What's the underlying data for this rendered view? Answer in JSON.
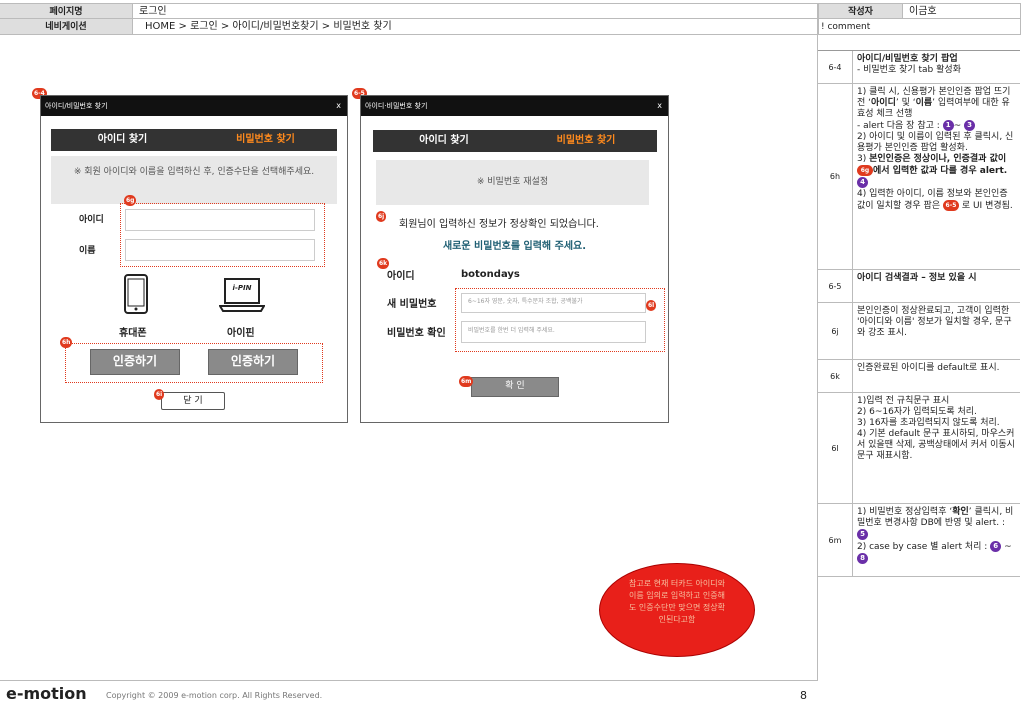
{
  "header": {
    "page_name_label": "페이지명",
    "page_name": "로그인",
    "nav_label": "네비게이션",
    "nav_path": "HOME > 로그인 > 아이디/비밀번호찾기 > 비밀번호 찾기",
    "author_label": "작성자",
    "author": "이금호",
    "comment_label": "! comment"
  },
  "popup1": {
    "marker": "6-4",
    "title": "아이디/비밀번호 찾기",
    "close": "x",
    "tab_id": "아이디 찾기",
    "tab_pw": "비밀번호 찾기",
    "notice": "※ 회원 아이디와 이름을 입력하신 후, 인증수단을 선택해주세요.",
    "badge_6g": "6g",
    "label_id": "아이디",
    "label_name": "이름",
    "phone_label": "휴대폰",
    "ipin_box": "i-PIN",
    "ipin_label": "아이핀",
    "badge_6h": "6h",
    "verify_btn_1": "인증하기",
    "verify_btn_2": "인증하기",
    "badge_6i": "6i",
    "close_btn": "닫 기"
  },
  "popup2": {
    "marker": "6-5",
    "title": "아이디·비밀번호 찾기",
    "close": "x",
    "tab_id": "아이디 찾기",
    "tab_pw": "비밀번호 찾기",
    "reset_title": "※ 비밀번호 재설정",
    "badge_6j": "6j",
    "ok_msg": "회원님이 입력하신 정보가 정상확인 되었습니다.",
    "new_pw_msg": "새로운 비밀번호를 입력해 주세요.",
    "badge_6k": "6k",
    "id_label": "아이디",
    "id_value": "botondays",
    "new_pw_label": "새 비밀번호",
    "new_pw_placeholder": "6~16자 영문, 숫자, 특수문자 조합, 공백불가",
    "badge_6l": "6l",
    "confirm_label": "비밀번호 확인",
    "confirm_placeholder": "비밀번호를 한번 더 입력해 주세요.",
    "badge_6m": "6m",
    "confirm_btn": "확 인"
  },
  "note_bubble": "참고로 현재 터카드 아이디와 이름 임의로 입력하고 인증해도 인증수단만 맞으면 정상확인된다고함",
  "comments": [
    {
      "num": "6-4",
      "text": "아이디/비밀번호 찾기 팝업\n- 비밀번호 찾기 tab 활성화"
    },
    {
      "num": "6h",
      "text": "1) 클릭 시, 신용평가 본인인증 팝업 뜨기 전 '아이디' 및 '이름' 입력여부에 대한 유효성 체크 선행\n- alert 다음 장 참고 : ❶~ ❸\n2) 아이디 및 이름이 입력된 후 클릭시, 신용평가 본인인증 팝업 활성화.\n3) 본인인증은 정상이나, 인증결과 값이 6g에서 입력한 값과 다를 경우 alert. ❹\n4) 입력한 아이디, 이름 정보와 본인인증 값이 일치할 경우 팝은 6-5 로 UI 변경됨."
    },
    {
      "num": "6-5",
      "text": "아이디 검색결과 – 정보 있을 시"
    },
    {
      "num": "6j",
      "text": "본인인증이 정상완료되고, 고객이 입력한 '아이디와 이름' 정보가 일치할 경우, 문구와 강조 표시."
    },
    {
      "num": "6k",
      "text": "인증완료된 아이디를 default로 표시."
    },
    {
      "num": "6l",
      "text": "1)입력 전 규칙문구 표시\n2) 6~16자가 입력되도록 처리.\n3) 16자를 초과입력되지 않도록 처리.\n 4) 기본 default 문구 표시하되, 마우스커서 있을땐 삭제, 공백상태에서 커서 이동시 문구 재표시함."
    },
    {
      "num": "6m",
      "text": "1) 비밀번호 정상입력후 '확인' 클릭시, 비밀번호 변경사항 DB에 반영 및 alert. : ❺\n2) case by case 별 alert 처리 : ❻ ~ ❽"
    }
  ],
  "footer": {
    "logo": "e-motion",
    "copyright": "Copyright © 2009 e-motion corp. All Rights Reserved.",
    "page_number": "8"
  }
}
